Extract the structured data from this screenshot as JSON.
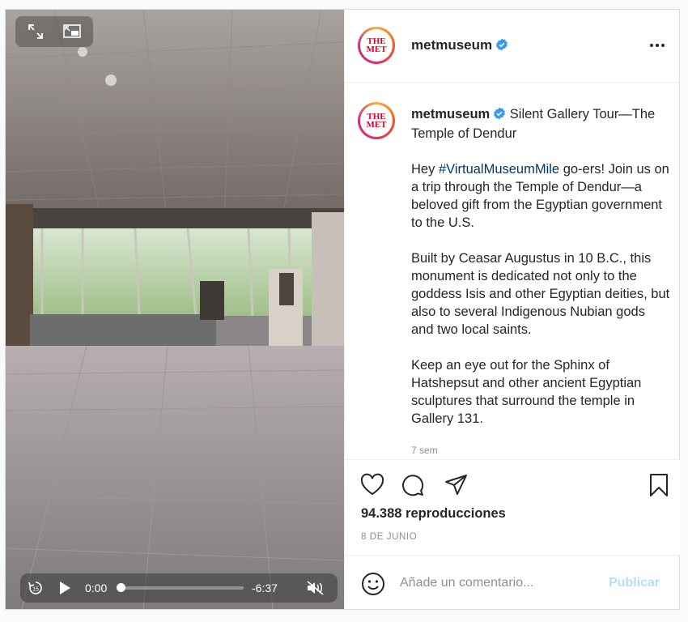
{
  "colors": {
    "accent": "#0095f6",
    "verified": "#3897f0",
    "publish_disabled": "#b2dffc",
    "logo_red": "#e4002b"
  },
  "video": {
    "icons": {
      "expand": "expand-icon",
      "pip": "picture-in-picture-icon",
      "replay": "replay-15-icon",
      "play": "play-icon",
      "mute": "muted-speaker-icon"
    },
    "current_time": "0:00",
    "remaining_time": "-6:37",
    "progress": 0.0
  },
  "header": {
    "logo_line1": "THE",
    "logo_line2": "MET",
    "username": "metmuseum",
    "verified_icon": "verified-badge-icon",
    "more_icon": "more-options-icon"
  },
  "caption": {
    "username": "metmuseum",
    "title": "Silent Gallery Tour—The Temple of Dendur",
    "p1_before": "Hey ",
    "hashtag": "#VirtualMuseumMile",
    "p1_after": " go-ers! Join us on a trip through the Temple of Dendur—a beloved gift from the Egyptian government to the U.S.",
    "p2": "Built by Ceasar Augustus in 10 B.C., this monument is dedicated not only to the goddess Isis and other Egyptian deities, but also to several Indigenous Nubian gods and two local saints.",
    "p3": "Keep an eye out for the Sphinx of Hatshepsut and other ancient Egyptian sculptures that surround the temple in Gallery 131.",
    "time_ago": "7 sem"
  },
  "actions": {
    "icons": {
      "like": "heart-icon",
      "comment": "comment-icon",
      "share": "share-icon",
      "save": "bookmark-icon"
    },
    "views": "94.388 reproducciones",
    "date": "8 DE JUNIO"
  },
  "comment": {
    "emoji_icon": "emoji-icon",
    "placeholder": "Añade un comentario...",
    "publish_label": "Publicar"
  }
}
